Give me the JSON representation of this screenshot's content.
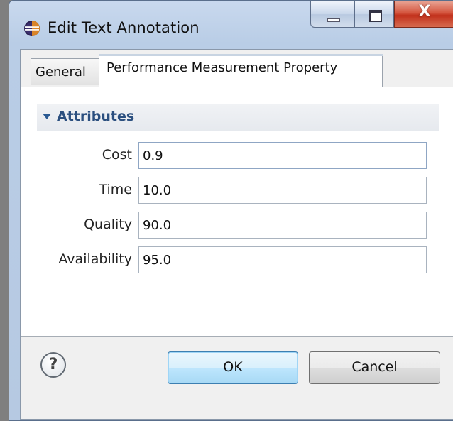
{
  "window": {
    "title": "Edit Text Annotation",
    "close_glyph": "X",
    "icons": {
      "app": "eclipse-icon",
      "minimize": "minimize-icon",
      "maximize": "maximize-icon",
      "close": "close-icon"
    }
  },
  "tabs": [
    {
      "label": "General",
      "active": false
    },
    {
      "label": "Performance Measurement Property",
      "active": true
    }
  ],
  "section": {
    "title": "Attributes",
    "expanded": true,
    "icon": "triangle-down-icon"
  },
  "fields": {
    "cost": {
      "label": "Cost",
      "value": "0.9"
    },
    "time": {
      "label": "Time",
      "value": "10.0"
    },
    "quality": {
      "label": "Quality",
      "value": "90.0"
    },
    "availability": {
      "label": "Availability",
      "value": "95.0"
    }
  },
  "footer": {
    "help_glyph": "?",
    "ok_label": "OK",
    "cancel_label": "Cancel"
  },
  "colors": {
    "section_title": "#2b4f7f",
    "close_button": "#c2311c",
    "ok_border": "#3c7fb1"
  }
}
